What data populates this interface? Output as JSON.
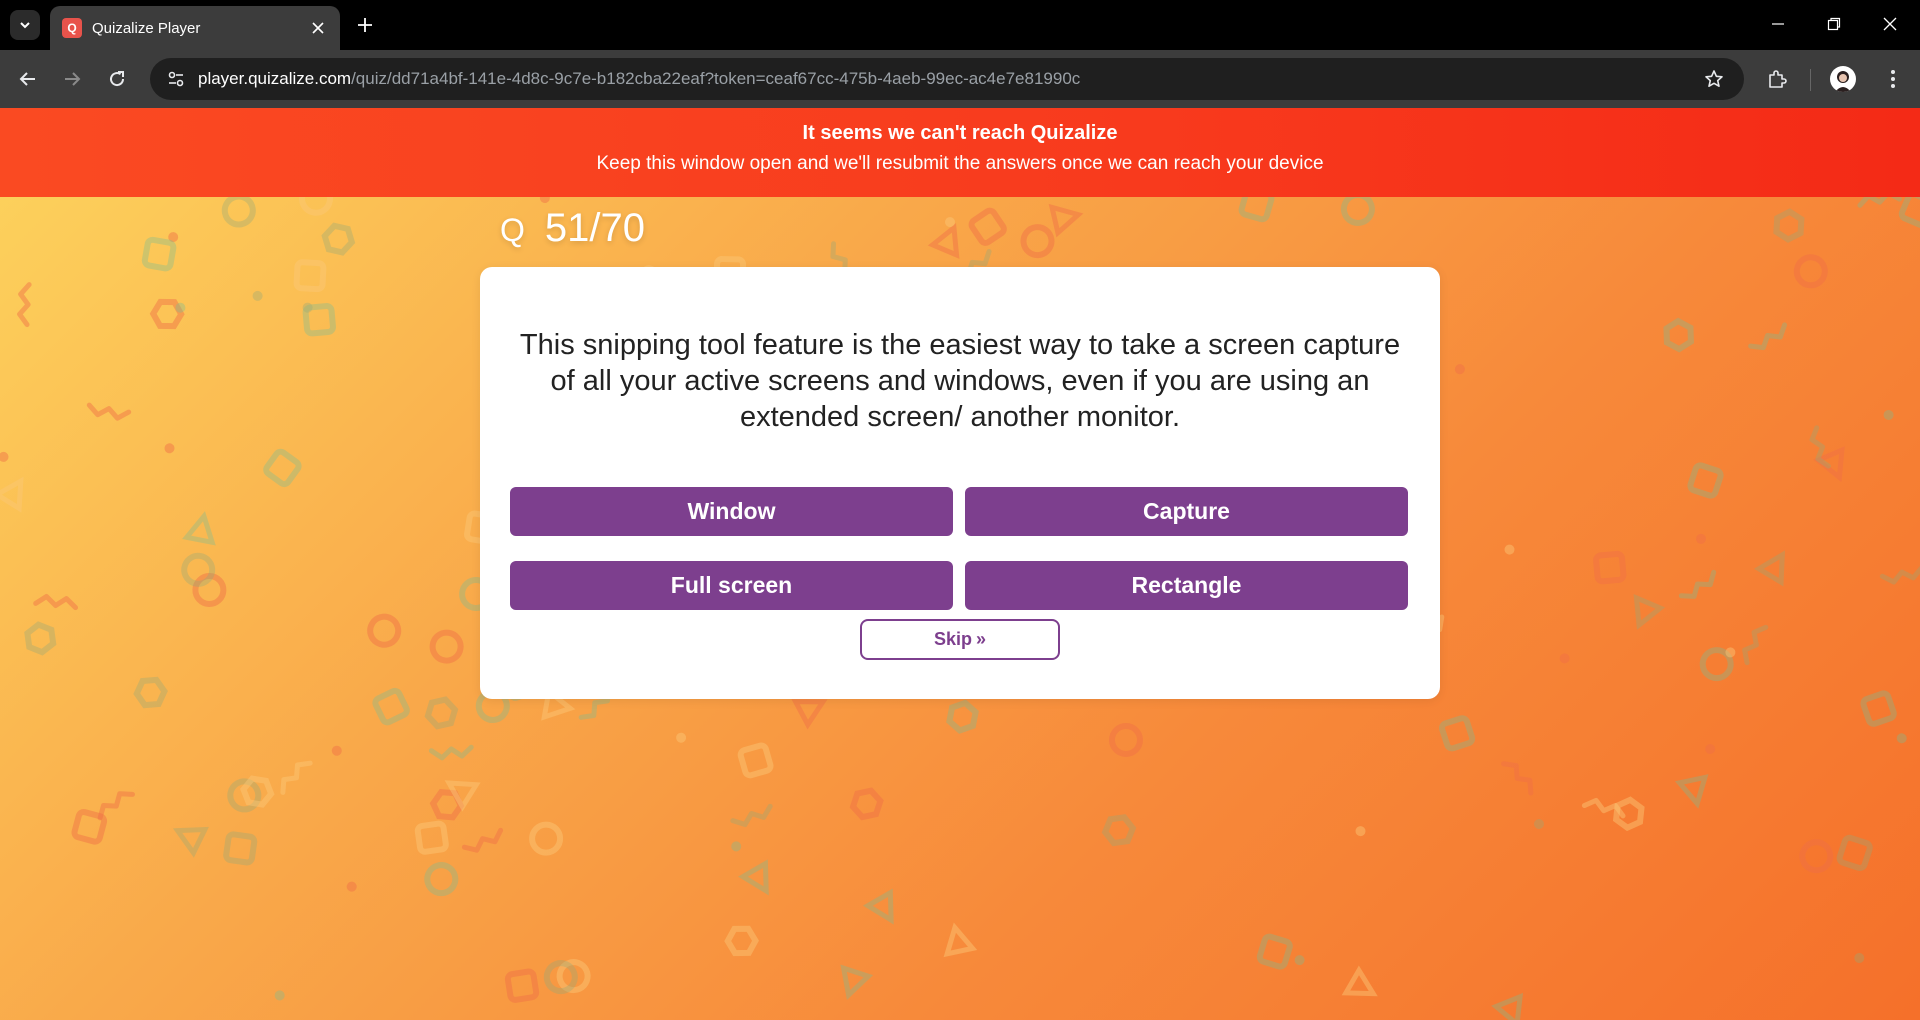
{
  "browser": {
    "tab_title": "Quizalize Player",
    "favicon_letter": "Q",
    "url_host": "player.quizalize.com",
    "url_path": "/quiz/dd71a4bf-141e-4d8c-9c7e-b182cba22eaf?token=ceaf67cc-475b-4aeb-99ec-ac4e7e81990c"
  },
  "banner": {
    "title": "It seems we can't reach Quizalize",
    "subtitle": "Keep this window open and we'll resubmit the answers once we can reach your device"
  },
  "quiz": {
    "counter_prefix": "Q",
    "counter": "51/70",
    "question": "This snipping tool feature is the easiest way to take a screen capture of all your active screens and windows, even if you are using an extended screen/ another monitor.",
    "answers": [
      "Window",
      "Capture",
      "Full screen",
      "Rectangle"
    ],
    "skip_label": "Skip",
    "skip_icon": "»"
  },
  "colors": {
    "accent_purple": "#7d3f8e",
    "banner_red": "#f83a1d",
    "bg_orange": "#f7893a"
  }
}
